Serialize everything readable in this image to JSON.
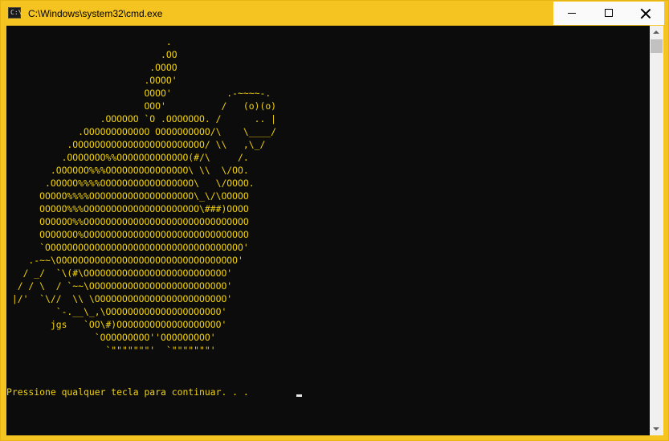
{
  "window": {
    "title": "C:\\Windows\\system32\\cmd.exe",
    "icon": "cmd-icon",
    "icon_glyph": "C:\\",
    "controls": [
      "minimize-icon",
      "maximize-icon",
      "close-icon"
    ],
    "accent_color": "#f5c421"
  },
  "console": {
    "text_color": "#f2d20a",
    "background_color": "#0c0c0c",
    "ascii_art": [
      "                             .",
      "                            .OO",
      "                          .OOOO",
      "                         .OOOO'",
      "                         OOOO'          .-~~~~-.",
      "                         OOO'          /   (o)(o)",
      "                 .OOOOOO `O .OOOOOOO. /      .. |",
      "             .OOOOOOOOOOOO OOOOOOOOOO/\\    \\____/",
      "           .OOOOOOOOOOOOOOOOOOOOOOOO/ \\\\   ,\\_/",
      "          .OOOOOOO%%OOOOOOOOOOOOO(#/\\     /.",
      "        .OOOOOO%%%OOOOOOOOOOOOOOO\\ \\\\  \\/OO.",
      "       .OOOOO%%%%OOOOOOOOOOOOOOOOO\\   \\/OOOO.",
      "      OOOOO%%%%OOOOOOOOOOOOOOOOOOO\\_\\/\\OOOOO",
      "      OOOOO%%%OOOOOOOOOOOOOOOOOOOOO\\###)OOOO",
      "      OOOOOO%%OOOOOOOOOOOOOOOOOOOOOOOOOOOOOO",
      "      OOOOOOO%OOOOOOOOOOOOOOOOOOOOOOOOOOOOOO",
      "      `OOOOOOOOOOOOOOOOOOOOOOOOOOOOOOOOOOOO'",
      "    .-~~\\OOOOOOOOOOOOOOOOOOOOOOOOOOOOOOOOO'",
      "   / _/  `\\(#\\OOOOOOOOOOOOOOOOOOOOOOOOOO'",
      "  / / \\  / `~~\\OOOOOOOOOOOOOOOOOOOOOOOOO'",
      " |/'  `\\//  \\\\ \\OOOOOOOOOOOOOOOOOOOOOOOO'",
      "         `-.__\\_,\\OOOOOOOOOOOOOOOOOOOOO'",
      "        jgs   `OO\\#)OOOOOOOOOOOOOOOOOOO'",
      "                `OOOOOOOOO''OOOOOOOOO'",
      "                  `\"\"\"\"\"\"\"'  `\"\"\"\"\"\"\"'"
    ],
    "prompt": "Pressione qualquer tecla para continuar. . ."
  }
}
